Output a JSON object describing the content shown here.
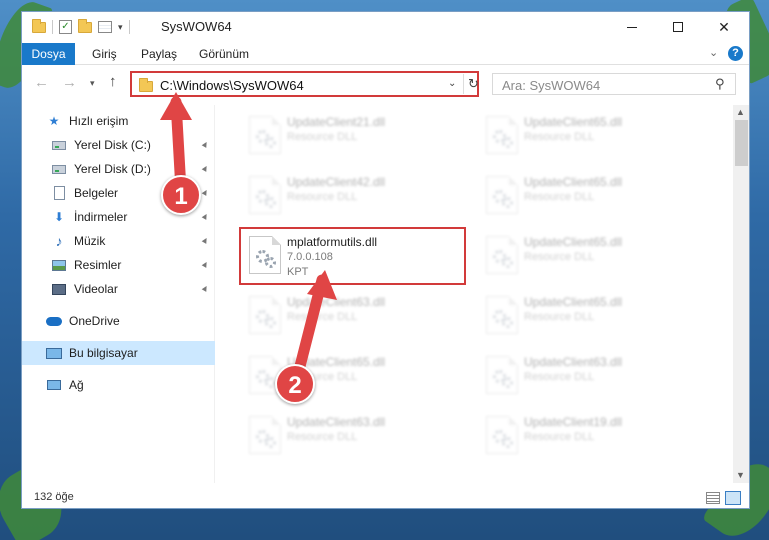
{
  "window": {
    "title": "SysWOW64",
    "controls": {
      "minimize": "",
      "maximize": "",
      "close": "✕"
    }
  },
  "quick_access_toolbar": {
    "dropdown": "▾"
  },
  "ribbon": {
    "tabs": [
      "Dosya",
      "Giriş",
      "Paylaş",
      "Görünüm"
    ],
    "collapse": "⌄",
    "help": "?"
  },
  "navigation": {
    "back": "←",
    "forward": "→",
    "recent_dropdown": "▾",
    "up": "↑",
    "address": "C:\\Windows\\SysWOW64",
    "address_dropdown": "⌄",
    "refresh": "↻",
    "search_placeholder": "Ara: SysWOW64",
    "search_icon": "⚲"
  },
  "sidebar": {
    "items": [
      {
        "label": "Hızlı erişim",
        "icon": "star-icon",
        "glyph": "★"
      },
      {
        "label": "Yerel Disk (C:)",
        "icon": "drive-icon"
      },
      {
        "label": "Yerel Disk (D:)",
        "icon": "drive-icon"
      },
      {
        "label": "Belgeler",
        "icon": "documents-icon"
      },
      {
        "label": "İndirmeler",
        "icon": "download-icon",
        "glyph": "⬇"
      },
      {
        "label": "Müzik",
        "icon": "music-icon",
        "glyph": "♪"
      },
      {
        "label": "Resimler",
        "icon": "pictures-icon"
      },
      {
        "label": "Videolar",
        "icon": "videos-icon"
      },
      {
        "label": "OneDrive",
        "icon": "cloud-icon"
      },
      {
        "label": "Bu bilgisayar",
        "icon": "computer-icon",
        "selected": true
      },
      {
        "label": "Ağ",
        "icon": "network-icon"
      }
    ],
    "pin_glyph": "📌"
  },
  "files": [
    {
      "name": "UpdateClient21.dll",
      "desc": "Resource DLL"
    },
    {
      "name": "UpdateClient65.dll",
      "desc": "Resource DLL"
    },
    {
      "name": "UpdateClient42.dll",
      "desc": "Resource DLL"
    },
    {
      "name": "UpdateClient65.dll",
      "desc": "Resource DLL"
    },
    {
      "name": "mplatformutils.dll",
      "desc": "7.0.0.108",
      "desc2": "KPT",
      "highlighted": true
    },
    {
      "name": "UpdateClient65.dll",
      "desc": "Resource DLL"
    },
    {
      "name": "UpdateClient63.dll",
      "desc": "Resource DLL"
    },
    {
      "name": "UpdateClient65.dll",
      "desc": "Resource DLL"
    },
    {
      "name": "UpdateClient65.dll",
      "desc": "Resource DLL"
    },
    {
      "name": "UpdateClient63.dll",
      "desc": "Resource DLL"
    },
    {
      "name": "UpdateClient63.dll",
      "desc": "Resource DLL"
    },
    {
      "name": "UpdateClient19.dll",
      "desc": "Resource DLL"
    }
  ],
  "status": {
    "count": "132 öğe"
  },
  "annotations": {
    "step1": "1",
    "step2": "2",
    "color": "#e04545"
  },
  "scrollbar": {
    "up": "▲",
    "down": "▼"
  }
}
